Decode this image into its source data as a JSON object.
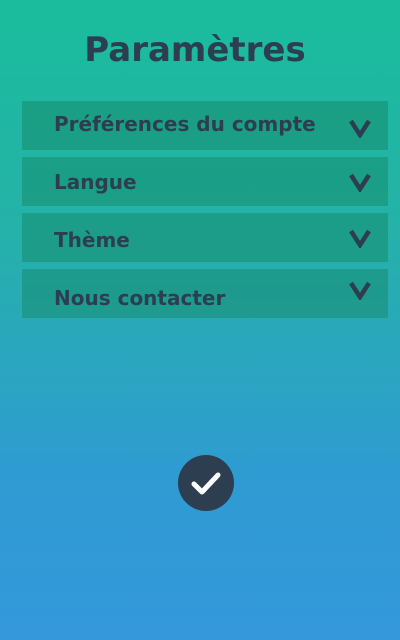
{
  "page": {
    "title": "Paramètres"
  },
  "menu": {
    "items": [
      {
        "label": "Préférences du compte",
        "icon": "chevron-down-icon"
      },
      {
        "label": "Langue",
        "icon": "chevron-down-icon"
      },
      {
        "label": "Thème",
        "icon": "chevron-down-icon"
      },
      {
        "label": "Nous contacter",
        "icon": "chevron-down-icon"
      }
    ]
  },
  "confirm": {
    "icon": "checkmark-icon"
  },
  "colors": {
    "background_top": "#1abc9c",
    "background_bottom": "#3498db",
    "text": "#2c3e50",
    "button": "#2c3e50",
    "check": "#ffffff"
  }
}
